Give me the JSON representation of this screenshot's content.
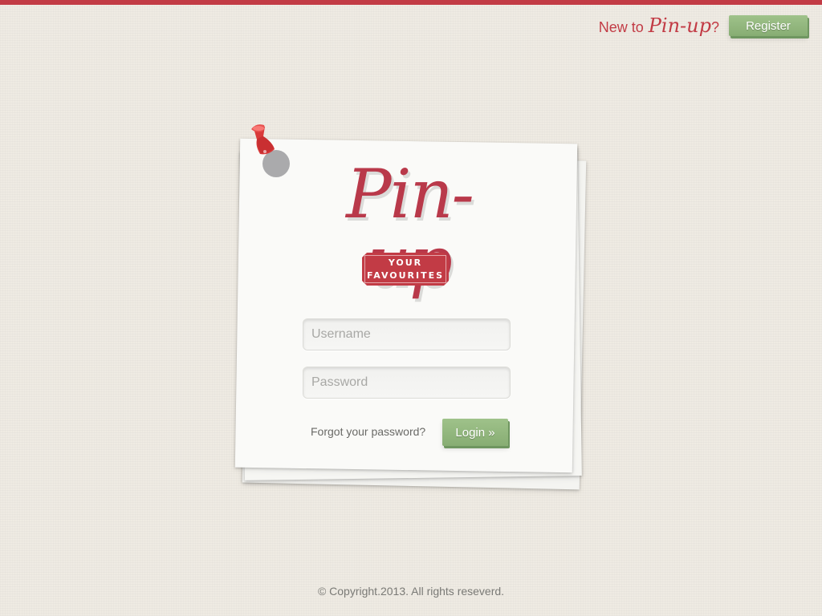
{
  "header": {
    "new_to_label": "New to",
    "brand": "Pin-up",
    "question_mark": "?",
    "register_label": "Register"
  },
  "logo": {
    "title": "Pin-up",
    "tagline_line1": "YOUR",
    "tagline_line2": "FAVOURITES"
  },
  "form": {
    "username_placeholder": "Username",
    "password_placeholder": "Password",
    "forgot_label": "Forgot your password?",
    "login_label": "Login »"
  },
  "footer": {
    "copyright": "© Copyright.2013. All rights reseverd."
  },
  "colors": {
    "accent": "#c23b45",
    "button": "#93b77f",
    "background": "#efebe3"
  },
  "icons": {
    "pin": "pushpin-icon"
  }
}
